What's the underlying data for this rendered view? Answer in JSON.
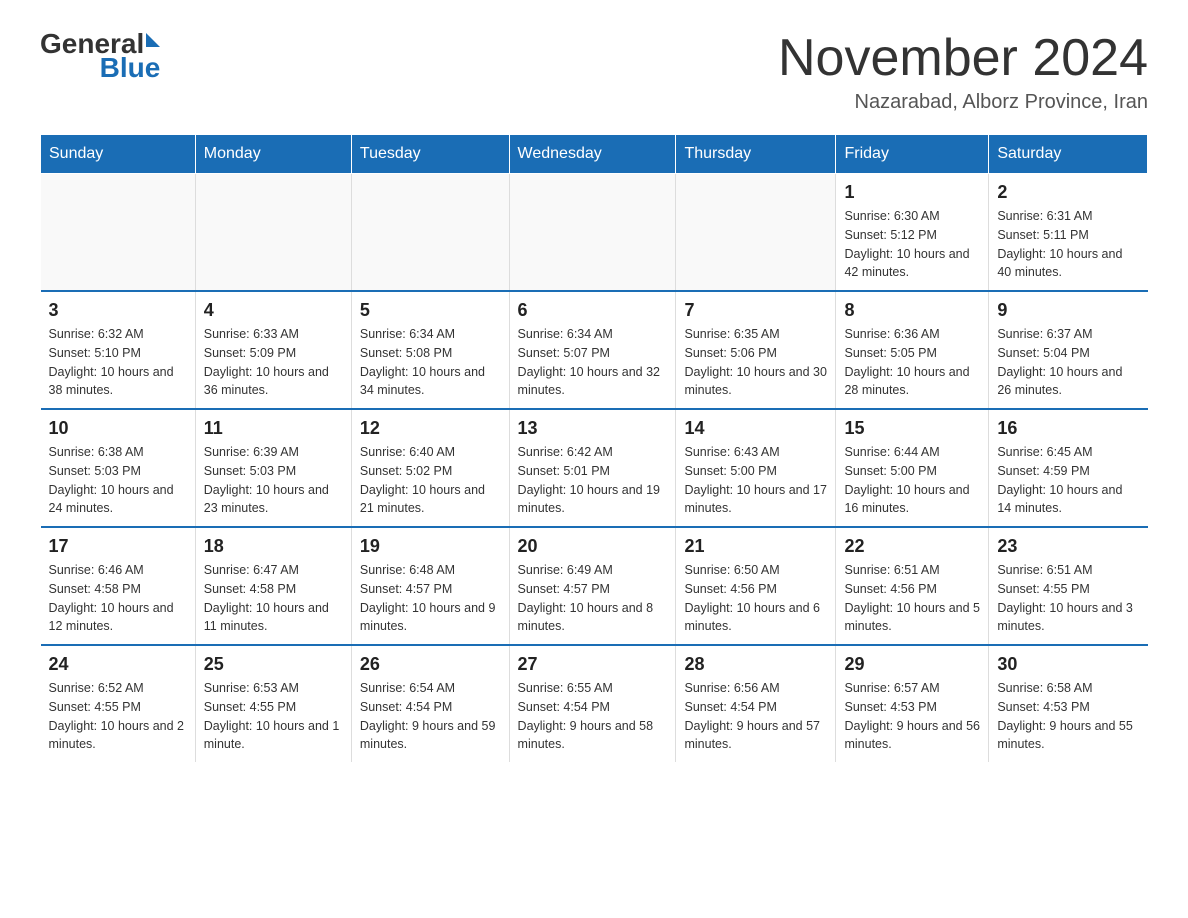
{
  "header": {
    "logo_general": "General",
    "logo_blue": "Blue",
    "title": "November 2024",
    "subtitle": "Nazarabad, Alborz Province, Iran"
  },
  "days_of_week": [
    "Sunday",
    "Monday",
    "Tuesday",
    "Wednesday",
    "Thursday",
    "Friday",
    "Saturday"
  ],
  "weeks": [
    [
      {
        "day": "",
        "info": ""
      },
      {
        "day": "",
        "info": ""
      },
      {
        "day": "",
        "info": ""
      },
      {
        "day": "",
        "info": ""
      },
      {
        "day": "",
        "info": ""
      },
      {
        "day": "1",
        "info": "Sunrise: 6:30 AM\nSunset: 5:12 PM\nDaylight: 10 hours and 42 minutes."
      },
      {
        "day": "2",
        "info": "Sunrise: 6:31 AM\nSunset: 5:11 PM\nDaylight: 10 hours and 40 minutes."
      }
    ],
    [
      {
        "day": "3",
        "info": "Sunrise: 6:32 AM\nSunset: 5:10 PM\nDaylight: 10 hours and 38 minutes."
      },
      {
        "day": "4",
        "info": "Sunrise: 6:33 AM\nSunset: 5:09 PM\nDaylight: 10 hours and 36 minutes."
      },
      {
        "day": "5",
        "info": "Sunrise: 6:34 AM\nSunset: 5:08 PM\nDaylight: 10 hours and 34 minutes."
      },
      {
        "day": "6",
        "info": "Sunrise: 6:34 AM\nSunset: 5:07 PM\nDaylight: 10 hours and 32 minutes."
      },
      {
        "day": "7",
        "info": "Sunrise: 6:35 AM\nSunset: 5:06 PM\nDaylight: 10 hours and 30 minutes."
      },
      {
        "day": "8",
        "info": "Sunrise: 6:36 AM\nSunset: 5:05 PM\nDaylight: 10 hours and 28 minutes."
      },
      {
        "day": "9",
        "info": "Sunrise: 6:37 AM\nSunset: 5:04 PM\nDaylight: 10 hours and 26 minutes."
      }
    ],
    [
      {
        "day": "10",
        "info": "Sunrise: 6:38 AM\nSunset: 5:03 PM\nDaylight: 10 hours and 24 minutes."
      },
      {
        "day": "11",
        "info": "Sunrise: 6:39 AM\nSunset: 5:03 PM\nDaylight: 10 hours and 23 minutes."
      },
      {
        "day": "12",
        "info": "Sunrise: 6:40 AM\nSunset: 5:02 PM\nDaylight: 10 hours and 21 minutes."
      },
      {
        "day": "13",
        "info": "Sunrise: 6:42 AM\nSunset: 5:01 PM\nDaylight: 10 hours and 19 minutes."
      },
      {
        "day": "14",
        "info": "Sunrise: 6:43 AM\nSunset: 5:00 PM\nDaylight: 10 hours and 17 minutes."
      },
      {
        "day": "15",
        "info": "Sunrise: 6:44 AM\nSunset: 5:00 PM\nDaylight: 10 hours and 16 minutes."
      },
      {
        "day": "16",
        "info": "Sunrise: 6:45 AM\nSunset: 4:59 PM\nDaylight: 10 hours and 14 minutes."
      }
    ],
    [
      {
        "day": "17",
        "info": "Sunrise: 6:46 AM\nSunset: 4:58 PM\nDaylight: 10 hours and 12 minutes."
      },
      {
        "day": "18",
        "info": "Sunrise: 6:47 AM\nSunset: 4:58 PM\nDaylight: 10 hours and 11 minutes."
      },
      {
        "day": "19",
        "info": "Sunrise: 6:48 AM\nSunset: 4:57 PM\nDaylight: 10 hours and 9 minutes."
      },
      {
        "day": "20",
        "info": "Sunrise: 6:49 AM\nSunset: 4:57 PM\nDaylight: 10 hours and 8 minutes."
      },
      {
        "day": "21",
        "info": "Sunrise: 6:50 AM\nSunset: 4:56 PM\nDaylight: 10 hours and 6 minutes."
      },
      {
        "day": "22",
        "info": "Sunrise: 6:51 AM\nSunset: 4:56 PM\nDaylight: 10 hours and 5 minutes."
      },
      {
        "day": "23",
        "info": "Sunrise: 6:51 AM\nSunset: 4:55 PM\nDaylight: 10 hours and 3 minutes."
      }
    ],
    [
      {
        "day": "24",
        "info": "Sunrise: 6:52 AM\nSunset: 4:55 PM\nDaylight: 10 hours and 2 minutes."
      },
      {
        "day": "25",
        "info": "Sunrise: 6:53 AM\nSunset: 4:55 PM\nDaylight: 10 hours and 1 minute."
      },
      {
        "day": "26",
        "info": "Sunrise: 6:54 AM\nSunset: 4:54 PM\nDaylight: 9 hours and 59 minutes."
      },
      {
        "day": "27",
        "info": "Sunrise: 6:55 AM\nSunset: 4:54 PM\nDaylight: 9 hours and 58 minutes."
      },
      {
        "day": "28",
        "info": "Sunrise: 6:56 AM\nSunset: 4:54 PM\nDaylight: 9 hours and 57 minutes."
      },
      {
        "day": "29",
        "info": "Sunrise: 6:57 AM\nSunset: 4:53 PM\nDaylight: 9 hours and 56 minutes."
      },
      {
        "day": "30",
        "info": "Sunrise: 6:58 AM\nSunset: 4:53 PM\nDaylight: 9 hours and 55 minutes."
      }
    ]
  ]
}
